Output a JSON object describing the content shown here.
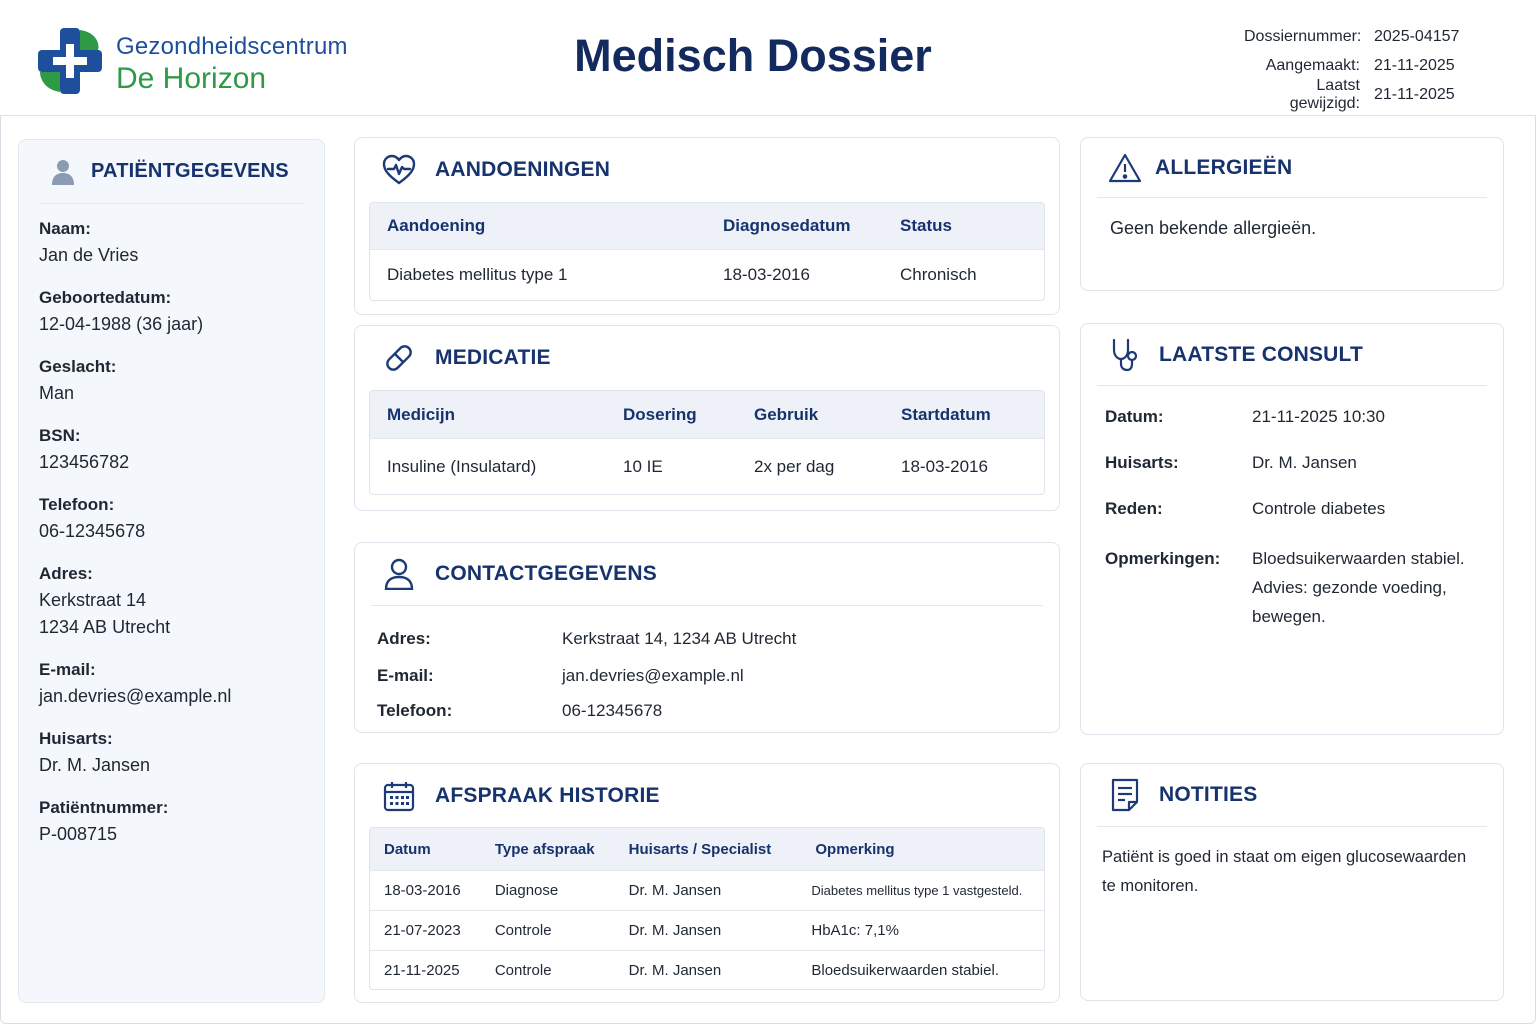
{
  "header": {
    "brand_line1": "Gezondheidscentrum",
    "brand_line2": "De Horizon",
    "title": "Medisch Dossier",
    "meta": [
      {
        "label": "Dossiernummer:",
        "value": "2025-04157"
      },
      {
        "label": "Aangemaakt:",
        "value": "21-11-2025"
      },
      {
        "label": "Laatst gewijzigd:",
        "value": "21-11-2025"
      }
    ]
  },
  "colors": {
    "brand_blue": "#1d4f9a",
    "brand_green": "#2f9a46",
    "heading_navy": "#17336e"
  },
  "patient": {
    "title": "PATIËNTGEGEVENS",
    "icon": "user-icon",
    "fields": [
      {
        "label": "Naam:",
        "value": "Jan de Vries"
      },
      {
        "label": "Geboortedatum:",
        "value": "12-04-1988 (36 jaar)"
      },
      {
        "label": "Geslacht:",
        "value": "Man"
      },
      {
        "label": "BSN:",
        "value": "123456782"
      },
      {
        "label": "Telefoon:",
        "value": "06-12345678"
      },
      {
        "label": "Adres:",
        "value": "Kerkstraat 14",
        "value2": "1234 AB Utrecht"
      },
      {
        "label": "E-mail:",
        "value": "jan.devries@example.nl"
      },
      {
        "label": "Huisarts:",
        "value": "Dr. M. Jansen"
      },
      {
        "label": "Patiëntnummer:",
        "value": "P-008715"
      }
    ]
  },
  "conditions": {
    "title": "AANDOENINGEN",
    "icon": "heart-pulse-icon",
    "headers": [
      "Aandoening",
      "Diagnosedatum",
      "Status"
    ],
    "rows": [
      [
        "Diabetes mellitus type 1",
        "18-03-2016",
        "Chronisch"
      ]
    ]
  },
  "medication": {
    "title": "MEDICATIE",
    "icon": "pill-icon",
    "headers": [
      "Medicijn",
      "Dosering",
      "Gebruik",
      "Startdatum"
    ],
    "rows": [
      [
        "Insuline (Insulatard)",
        "10 IE",
        "2x per dag",
        "18-03-2016"
      ]
    ]
  },
  "contact": {
    "title": "CONTACTGEGEVENS",
    "icon": "person-outline-icon",
    "rows": [
      {
        "label": "Adres:",
        "value": "Kerkstraat 14, 1234 AB Utrecht"
      },
      {
        "label": "E-mail:",
        "value": "jan.devries@example.nl"
      },
      {
        "label": "Telefoon:",
        "value": "06-12345678"
      }
    ]
  },
  "appointments": {
    "title": "AFSPRAAK HISTORIE",
    "icon": "calendar-icon",
    "headers": [
      "Datum",
      "Type afspraak",
      "Huisarts / Specialist",
      "Opmerking"
    ],
    "rows": [
      [
        "18-03-2016",
        "Diagnose",
        "Dr. M. Jansen",
        "Diabetes mellitus type 1 vastgesteld."
      ],
      [
        "21-07-2023",
        "Controle",
        "Dr. M. Jansen",
        "HbA1c: 7,1%"
      ],
      [
        "21-11-2025",
        "Controle",
        "Dr. M. Jansen",
        "Bloedsuikerwaarden stabiel."
      ]
    ]
  },
  "allergies": {
    "title": "ALLERGIEËN",
    "icon": "warning-icon",
    "text": "Geen bekende allergieën."
  },
  "consult": {
    "title": "LAATSTE CONSULT",
    "icon": "stethoscope-icon",
    "rows": [
      {
        "label": "Datum:",
        "value": "21-11-2025 10:30"
      },
      {
        "label": "Huisarts:",
        "value": "Dr. M. Jansen"
      },
      {
        "label": "Reden:",
        "value": "Controle diabetes"
      },
      {
        "label": "Opmerkingen:",
        "lines": [
          "Bloedsuikerwaarden stabiel.",
          "Advies: gezonde voeding,",
          "bewegen."
        ]
      }
    ]
  },
  "notes": {
    "title": "NOTITIES",
    "icon": "note-icon",
    "lines": [
      "Patiënt is goed in staat om eigen glucosewaarden",
      "te monitoren."
    ]
  }
}
